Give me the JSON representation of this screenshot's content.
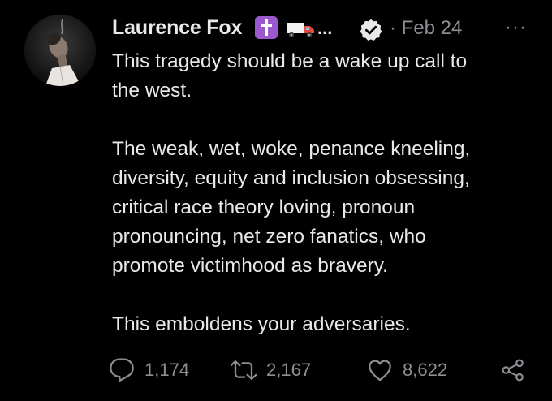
{
  "tweet": {
    "author_name": "Laurence Fox",
    "truncation": "...",
    "date": "· Feb 24",
    "more": "···",
    "paragraphs": [
      {
        "lines": [
          "This tragedy should be a wake up call to",
          "the west."
        ]
      },
      {
        "lines": [
          "The weak, wet, woke, penance kneeling,",
          "diversity, equity and inclusion obsessing,",
          "critical race theory loving, pronoun",
          "pronouncing, net zero fanatics, who",
          "promote victimhood as bravery."
        ]
      },
      {
        "lines": [
          "This emboldens your adversaries."
        ]
      }
    ],
    "icons": {
      "avatar": "avatar",
      "cross": "latin-cross-emoji-icon",
      "truck": "delivery-truck-emoji-icon",
      "verified": "verified-badge-icon",
      "reply": "reply-icon",
      "retweet": "retweet-icon",
      "like": "heart-icon",
      "share": "share-icon"
    },
    "stats": {
      "replies": "1,174",
      "retweets": "2,167",
      "likes": "8,622"
    },
    "colors": {
      "background": "#000000",
      "text": "#e7e9ea",
      "muted": "#8b8f93",
      "cross_emoji_bg": "#9b59d0",
      "verified": "#e7e9ea"
    }
  }
}
